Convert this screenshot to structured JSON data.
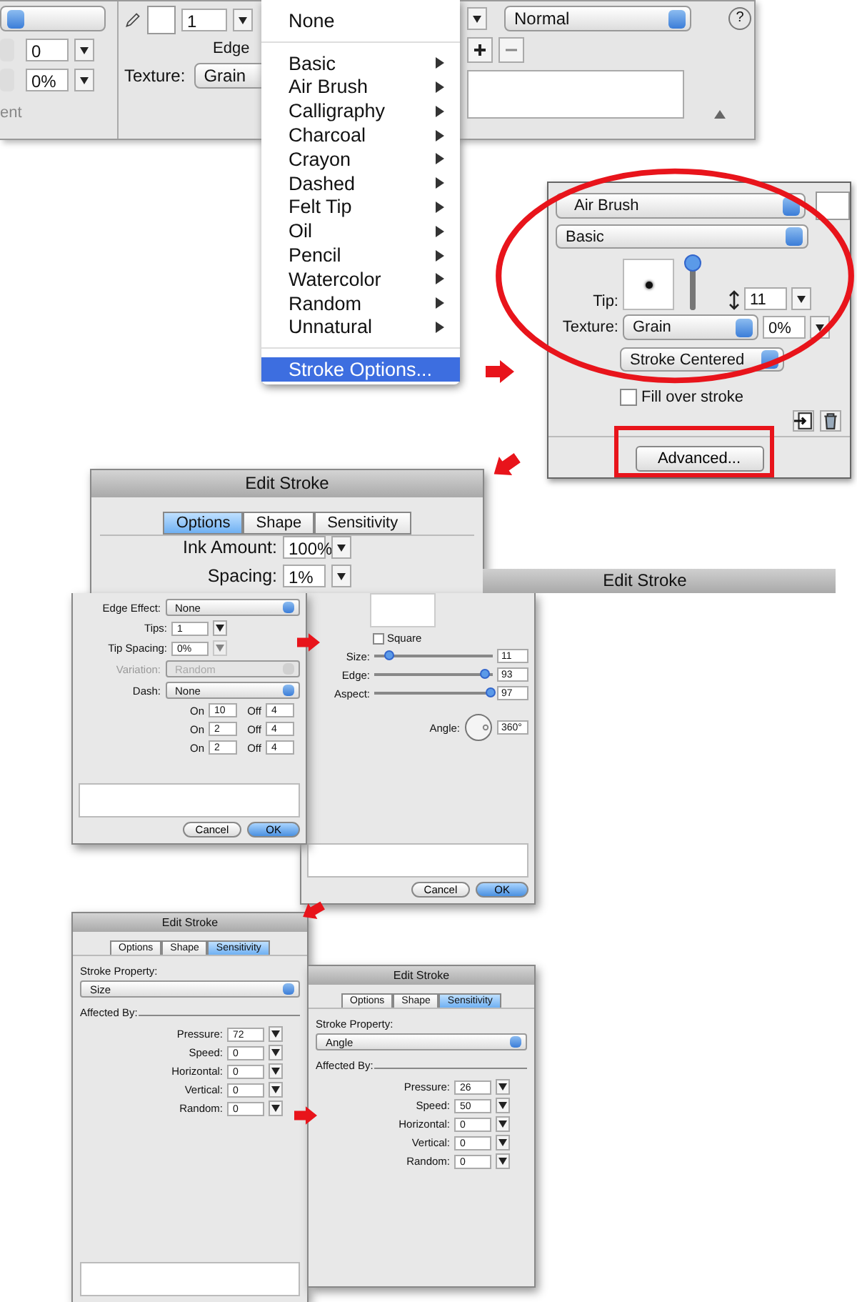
{
  "inspector": {
    "left_values": [
      "0",
      "0%"
    ],
    "left_caption": "ent",
    "stroke_size": "1",
    "edge_label": "Edge",
    "texture_label": "Texture:",
    "texture": "Grain",
    "blend": "Normal",
    "help": "?"
  },
  "stroke_menu": [
    {
      "label": "None",
      "kind": "plain",
      "selected": false
    },
    {
      "label": "Basic",
      "kind": "submenu",
      "selected": false
    },
    {
      "label": "Air Brush",
      "kind": "submenu",
      "selected": false
    },
    {
      "label": "Calligraphy",
      "kind": "submenu",
      "selected": false
    },
    {
      "label": "Charcoal",
      "kind": "submenu",
      "selected": false
    },
    {
      "label": "Crayon",
      "kind": "submenu",
      "selected": false
    },
    {
      "label": "Dashed",
      "kind": "submenu",
      "selected": false
    },
    {
      "label": "Felt Tip",
      "kind": "submenu",
      "selected": false
    },
    {
      "label": "Oil",
      "kind": "submenu",
      "selected": false
    },
    {
      "label": "Pencil",
      "kind": "submenu",
      "selected": false
    },
    {
      "label": "Watercolor",
      "kind": "submenu",
      "selected": false
    },
    {
      "label": "Random",
      "kind": "submenu",
      "selected": false
    },
    {
      "label": "Unnatural",
      "kind": "submenu",
      "selected": false
    },
    {
      "label": "Stroke Options...",
      "kind": "command",
      "selected": true
    }
  ],
  "stroke_panel": {
    "category": "Air Brush",
    "type": "Basic",
    "tip_label": "Tip:",
    "tip_slider": {
      "level": 0.9
    },
    "size": "11",
    "texture_label": "Texture:",
    "texture": "Grain",
    "texture_amount": "0%",
    "placement": "Stroke Centered",
    "fill_over_stroke": {
      "label": "Fill over stroke",
      "checked": false
    },
    "advanced": "Advanced..."
  },
  "dialogs": [
    {
      "kind": "options",
      "title": "Edit Stroke",
      "tabs": [
        {
          "label": "Options",
          "selected": true
        },
        {
          "label": "Shape",
          "selected": false
        },
        {
          "label": "Sensitivity",
          "selected": false
        }
      ],
      "fields": [
        {
          "label": "Ink Amount:",
          "value": "100%"
        },
        {
          "label": "Spacing:",
          "value": "1%"
        }
      ]
    },
    {
      "kind": "shape",
      "title": "Edit Stroke",
      "square": {
        "label": "Square",
        "checked": false
      },
      "sliders": [
        {
          "label": "Size:",
          "level": 0.12,
          "value": "11"
        },
        {
          "label": "Edge:",
          "level": 0.93,
          "value": "93"
        },
        {
          "label": "Aspect:",
          "level": 0.97,
          "value": "97"
        }
      ],
      "angle_label": "Angle:",
      "angle": "360°",
      "buttons": [
        {
          "label": "Cancel",
          "default": false
        },
        {
          "label": "OK",
          "default": true
        }
      ]
    },
    {
      "kind": "options_detail",
      "rows": [
        {
          "kind": "select",
          "label": "Edge Effect:",
          "value": "None",
          "disabled": false
        },
        {
          "kind": "number",
          "label": "Tips:",
          "value": "1",
          "disabled": false
        },
        {
          "kind": "number",
          "label": "Tip Spacing:",
          "value": "0%",
          "disabled": true
        },
        {
          "kind": "select",
          "label": "Variation:",
          "value": "Random",
          "disabled": true
        },
        {
          "kind": "select",
          "label": "Dash:",
          "value": "None",
          "disabled": false
        }
      ],
      "dashes": [
        {
          "on_label": "On",
          "on": "10",
          "off_label": "Off",
          "off": "4"
        },
        {
          "on_label": "On",
          "on": "2",
          "off_label": "Off",
          "off": "4"
        },
        {
          "on_label": "On",
          "on": "2",
          "off_label": "Off",
          "off": "4"
        }
      ],
      "buttons": [
        {
          "label": "Cancel",
          "default": false
        },
        {
          "label": "OK",
          "default": true
        }
      ]
    },
    {
      "kind": "sensitivity",
      "title": "Edit Stroke",
      "tabs": [
        {
          "label": "Options",
          "selected": false
        },
        {
          "label": "Shape",
          "selected": false
        },
        {
          "label": "Sensitivity",
          "selected": true
        }
      ],
      "property_label": "Stroke Property:",
      "property": "Size",
      "affected_label": "Affected By:",
      "rows": [
        {
          "label": "Pressure:",
          "value": "72"
        },
        {
          "label": "Speed:",
          "value": "0"
        },
        {
          "label": "Horizontal:",
          "value": "0"
        },
        {
          "label": "Vertical:",
          "value": "0"
        },
        {
          "label": "Random:",
          "value": "0"
        }
      ]
    },
    {
      "kind": "sensitivity",
      "title": "Edit Stroke",
      "tabs": [
        {
          "label": "Options",
          "selected": false
        },
        {
          "label": "Shape",
          "selected": false
        },
        {
          "label": "Sensitivity",
          "selected": true
        }
      ],
      "property_label": "Stroke Property:",
      "property": "Angle",
      "affected_label": "Affected By:",
      "rows": [
        {
          "label": "Pressure:",
          "value": "26"
        },
        {
          "label": "Speed:",
          "value": "50"
        },
        {
          "label": "Horizontal:",
          "value": "0"
        },
        {
          "label": "Vertical:",
          "value": "0"
        },
        {
          "label": "Random:",
          "value": "0"
        }
      ]
    }
  ]
}
